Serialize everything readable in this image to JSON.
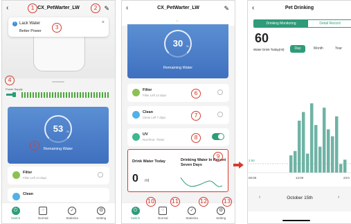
{
  "colors": {
    "accent": "#2e9b79",
    "annot": "#d83a2e",
    "blue": "#4a7fcb",
    "bar": "#6fb3a5"
  },
  "phone1": {
    "title": "CX_PetWarter_LW",
    "alert_title": "Lack Water",
    "alert_sub": "Better Power",
    "power_label": "Power Supply",
    "percent": "53",
    "percent_unit": "%",
    "remaining": "Remaining Water",
    "cards": [
      {
        "title": "Filter",
        "sub": "Filter Left 14 days"
      },
      {
        "title": "Clean",
        "sub": ""
      }
    ]
  },
  "phone2": {
    "title": "CX_PetWarter_LW",
    "percent": "30",
    "percent_unit": "%",
    "remaining": "Remaining Water",
    "cards": [
      {
        "title": "Filter",
        "sub": "Filter Left 14 days"
      },
      {
        "title": "Clean",
        "sub": "Clean Left 7 days"
      },
      {
        "title": "UV",
        "sub": "RunTime: 70min"
      }
    ],
    "drink_today": "Drink Water Today",
    "drink_val": "0",
    "drink_unit": "ml",
    "drink_recent": "Drinking Water In Recent Seven Days"
  },
  "tabs": [
    "Switch",
    "Normal",
    "Statistics",
    "Setting"
  ],
  "annotations": [
    "1",
    "2",
    "3",
    "4",
    "5",
    "6",
    "7",
    "8",
    "9",
    "10",
    "11",
    "12",
    "13"
  ],
  "phone3": {
    "title": "Pet Drinking",
    "tab_monitor": "Drinking Monitoring",
    "tab_detail": "Detail Record",
    "big_value": "60",
    "drink_label": "Water Drink Today(ml)",
    "periods": [
      "Day",
      "Month",
      "Year"
    ],
    "date": "October 15th",
    "chart_data": {
      "type": "bar",
      "x_ticks": [
        "00:00",
        "12:00",
        "23:0"
      ],
      "ref_line": "2.50",
      "values": [
        0.2,
        0.25,
        0.6,
        0.7,
        0.22,
        0.8,
        0.55,
        0.3,
        0.75,
        0.5,
        0.42,
        0.65,
        0.1,
        0.15
      ]
    }
  }
}
